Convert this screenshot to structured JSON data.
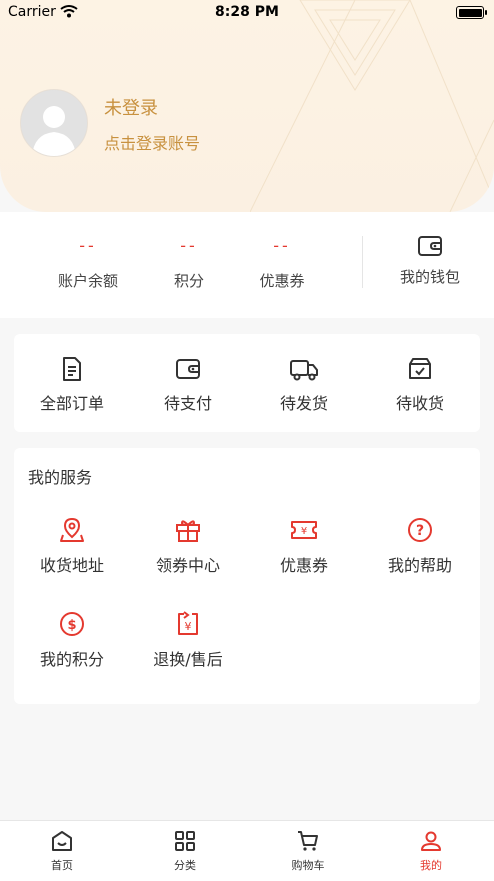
{
  "status_bar": {
    "carrier": "Carrier",
    "time": "8:28 PM"
  },
  "profile": {
    "title": "未登录",
    "subtitle": "点击登录账号"
  },
  "stats": [
    {
      "value": "--",
      "label": "账户余额"
    },
    {
      "value": "--",
      "label": "积分"
    },
    {
      "value": "--",
      "label": "优惠券"
    }
  ],
  "wallet": {
    "label": "我的钱包",
    "icon": "wallet-icon"
  },
  "orders": [
    {
      "label": "全部订单",
      "icon": "document-icon"
    },
    {
      "label": "待支付",
      "icon": "wallet-icon"
    },
    {
      "label": "待发货",
      "icon": "truck-icon"
    },
    {
      "label": "待收货",
      "icon": "box-check-icon"
    }
  ],
  "services": {
    "title": "我的服务",
    "items": [
      {
        "label": "收货地址",
        "icon": "location-icon"
      },
      {
        "label": "领券中心",
        "icon": "gift-icon"
      },
      {
        "label": "优惠券",
        "icon": "coupon-icon"
      },
      {
        "label": "我的帮助",
        "icon": "help-icon"
      },
      {
        "label": "我的积分",
        "icon": "dollar-icon"
      },
      {
        "label": "退换/售后",
        "icon": "refund-icon"
      }
    ]
  },
  "tabs": [
    {
      "label": "首页",
      "icon": "home-icon"
    },
    {
      "label": "分类",
      "icon": "grid-icon"
    },
    {
      "label": "购物车",
      "icon": "cart-icon"
    },
    {
      "label": "我的",
      "icon": "user-icon",
      "active": true
    }
  ],
  "colors": {
    "accent": "#e4392f",
    "gold": "#c8913f",
    "header_bg": "#fdf3e4"
  }
}
